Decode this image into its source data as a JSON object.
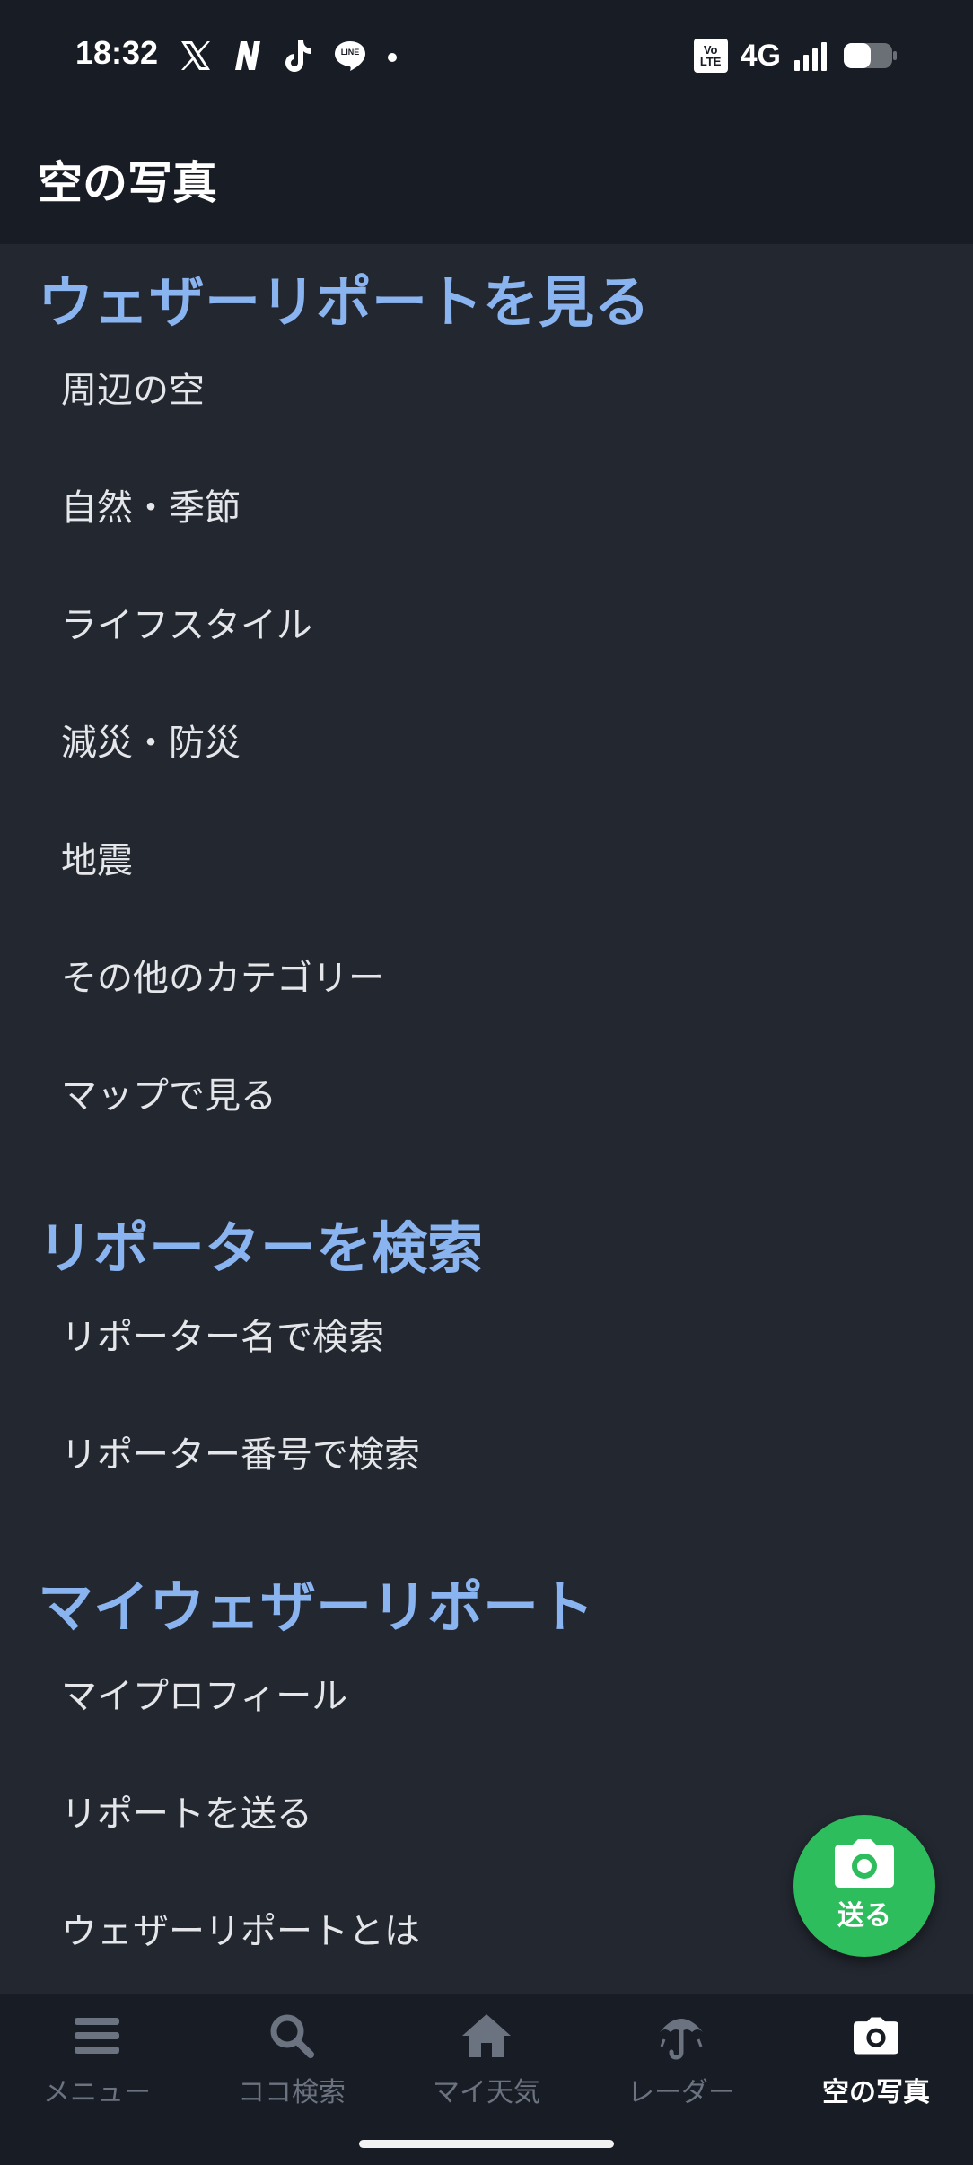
{
  "status_bar": {
    "time": "18:32",
    "apps": [
      "x-icon",
      "n-app-icon",
      "tiktok-icon",
      "line-icon"
    ],
    "line_badge": "LINE",
    "volte_badge_top": "Vo",
    "volte_badge_bottom": "LTE",
    "network": "4G"
  },
  "header": {
    "title": "空の写真"
  },
  "sections": [
    {
      "heading": "ウェザーリポートを見る",
      "items": [
        "周辺の空",
        "自然・季節",
        "ライフスタイル",
        "減災・防災",
        "地震",
        "その他のカテゴリー",
        "マップで見る"
      ]
    },
    {
      "heading": "リポーターを検索",
      "items": [
        "リポーター名で検索",
        "リポーター番号で検索"
      ]
    },
    {
      "heading": "マイウェザーリポート",
      "items": [
        "マイプロフィール",
        "リポートを送る",
        "ウェザーリポートとは"
      ]
    }
  ],
  "fab": {
    "label": "送る",
    "icon": "camera-icon",
    "color": "#2dbd5c"
  },
  "bottom_nav": [
    {
      "label": "メニュー",
      "icon": "hamburger-menu-icon",
      "active": false
    },
    {
      "label": "ココ検索",
      "icon": "search-icon",
      "active": false
    },
    {
      "label": "マイ天気",
      "icon": "home-icon",
      "active": false
    },
    {
      "label": "レーダー",
      "icon": "umbrella-radar-icon",
      "active": false
    },
    {
      "label": "空の写真",
      "icon": "camera-icon",
      "active": true
    }
  ],
  "colors": {
    "background": "#232730",
    "header": "#181c24",
    "heading_accent": "#8ab4f0",
    "nav_inactive": "#6b7280",
    "nav_active": "#ffffff"
  }
}
